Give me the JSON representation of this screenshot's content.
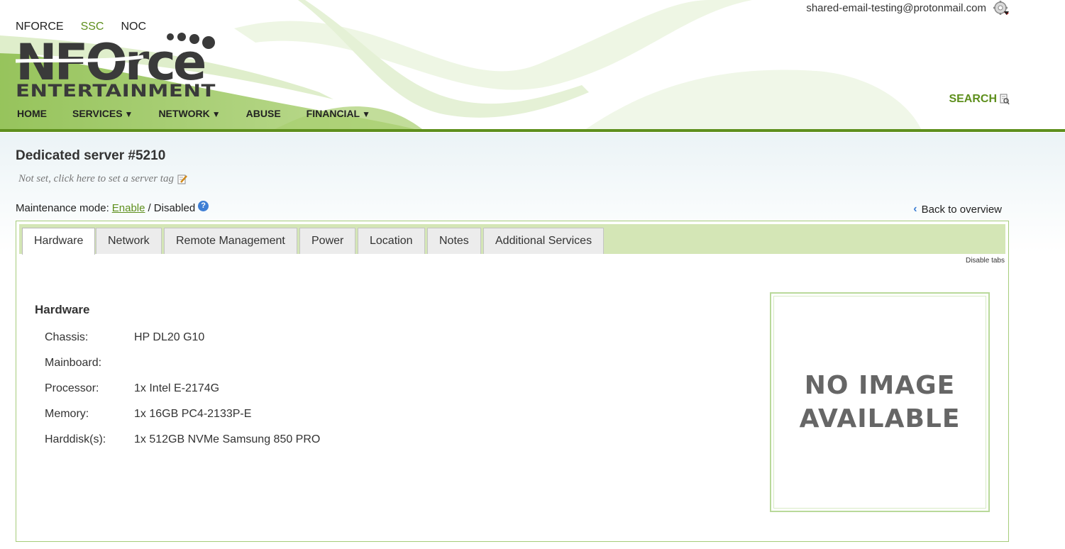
{
  "header": {
    "top_links": [
      "NFORCE",
      "SSC",
      "NOC"
    ],
    "user_email": "shared-email-testing@protonmail.com",
    "logo_line1": "NFOrce",
    "logo_line2": "ENTERTAINMENT",
    "nav": [
      {
        "label": "HOME",
        "caret": ""
      },
      {
        "label": "SERVICES",
        "caret": "▼"
      },
      {
        "label": "NETWORK",
        "caret": "▼"
      },
      {
        "label": "ABUSE",
        "caret": ""
      },
      {
        "label": "FINANCIAL",
        "caret": "▼"
      }
    ],
    "search_label": "SEARCH"
  },
  "page": {
    "title": "Dedicated server #5210",
    "server_tag": "Not set, click here to set a server tag",
    "maintenance_label": "Maintenance mode:",
    "maintenance_enable": "Enable",
    "maintenance_separator": "/ Disabled",
    "back_label": "Back to overview"
  },
  "tabs": [
    "Hardware",
    "Network",
    "Remote Management",
    "Power",
    "Location",
    "Notes",
    "Additional Services"
  ],
  "disable_tabs_label": "Disable tabs",
  "hardware": {
    "title": "Hardware",
    "rows": [
      {
        "label": "Chassis:",
        "value": "HP DL20 G10"
      },
      {
        "label": "Mainboard:",
        "value": ""
      },
      {
        "label": "Processor:",
        "value": "1x Intel E-2174G"
      },
      {
        "label": "Memory:",
        "value": "1x 16GB PC4-2133P-E"
      },
      {
        "label": "Harddisk(s):",
        "value": "1x 512GB NVMe Samsung 850 PRO"
      }
    ]
  },
  "no_image": {
    "line1": "NO IMAGE",
    "line2": "AVAILABLE"
  },
  "colors": {
    "brand_green": "#5e8f1d",
    "tabbar_green": "#d4e6b6",
    "link_blue": "#3f7fd4"
  }
}
